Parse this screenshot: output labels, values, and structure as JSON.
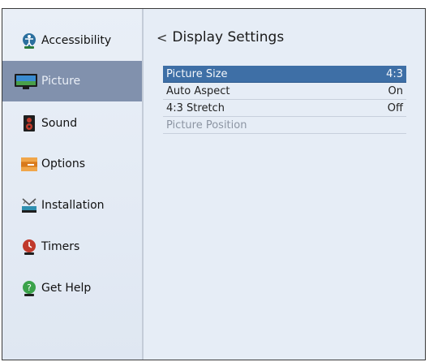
{
  "sidebar": {
    "items": [
      {
        "label": "Accessibility",
        "icon": "accessibility-icon"
      },
      {
        "label": "Picture",
        "icon": "tv-picture-icon"
      },
      {
        "label": "Sound",
        "icon": "speaker-icon"
      },
      {
        "label": "Options",
        "icon": "options-drawer-icon"
      },
      {
        "label": "Installation",
        "icon": "installation-antenna-icon"
      },
      {
        "label": "Timers",
        "icon": "timer-icon"
      },
      {
        "label": "Get Help",
        "icon": "help-icon"
      }
    ],
    "selected": "Picture"
  },
  "main": {
    "title": "Display Settings",
    "back_glyph": "<",
    "rows": [
      {
        "label": "Picture Size",
        "value": "4:3",
        "state": "selected"
      },
      {
        "label": "Auto Aspect",
        "value": "On",
        "state": "normal"
      },
      {
        "label": "4:3 Stretch",
        "value": "Off",
        "state": "normal"
      },
      {
        "label": "Picture Position",
        "value": "",
        "state": "disabled"
      }
    ]
  },
  "colors": {
    "background": "#e6edf6",
    "sidebar_selected": "#8191ad",
    "row_selected": "#3e6fa6",
    "disabled_text": "#8c95a3"
  }
}
